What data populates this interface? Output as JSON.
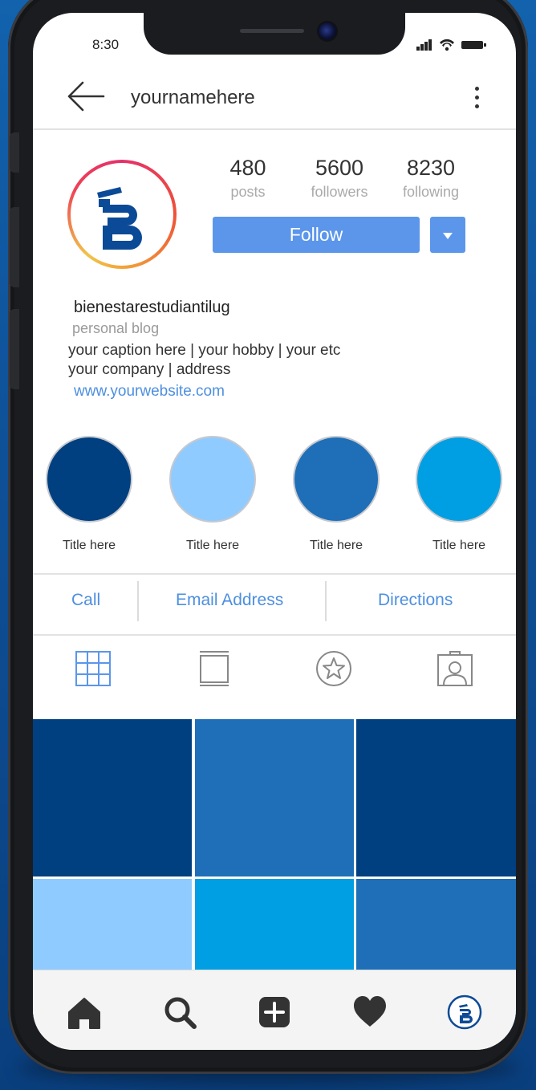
{
  "status_bar": {
    "time": "8:30"
  },
  "header": {
    "username": "yournamehere"
  },
  "profile": {
    "stats": [
      {
        "value": "480",
        "label": "posts"
      },
      {
        "value": "5600",
        "label": "followers"
      },
      {
        "value": "8230",
        "label": "following"
      }
    ],
    "follow_label": "Follow",
    "display_name": "bienestarestudiantilug",
    "category": "personal blog",
    "bio_line1": "your caption here  | your hobby | your etc",
    "bio_line2": "your company | address",
    "website": "www.yourwebsite.com"
  },
  "highlights": [
    {
      "title": "Title here",
      "color": "#003f80"
    },
    {
      "title": "Title here",
      "color": "#90cbff"
    },
    {
      "title": "Title here",
      "color": "#1e6fb8"
    },
    {
      "title": "Title here",
      "color": "#009fe3"
    }
  ],
  "contact": {
    "call": "Call",
    "email": "Email Address",
    "directions": "Directions"
  },
  "tabs": [
    "grid-icon",
    "igtv-icon",
    "star-icon",
    "tagged-icon"
  ],
  "posts_grid": [
    "#003f80",
    "#1e6fb8",
    "#003f80",
    "#90cbff",
    "#009fe3",
    "#1e6fb8"
  ],
  "bottom_nav": [
    "home-icon",
    "search-icon",
    "add-post-icon",
    "heart-icon",
    "profile-avatar-icon"
  ],
  "colors": {
    "accent": "#5b96eb",
    "link": "#4d8fe0",
    "brand_navy": "#0b4a96"
  }
}
